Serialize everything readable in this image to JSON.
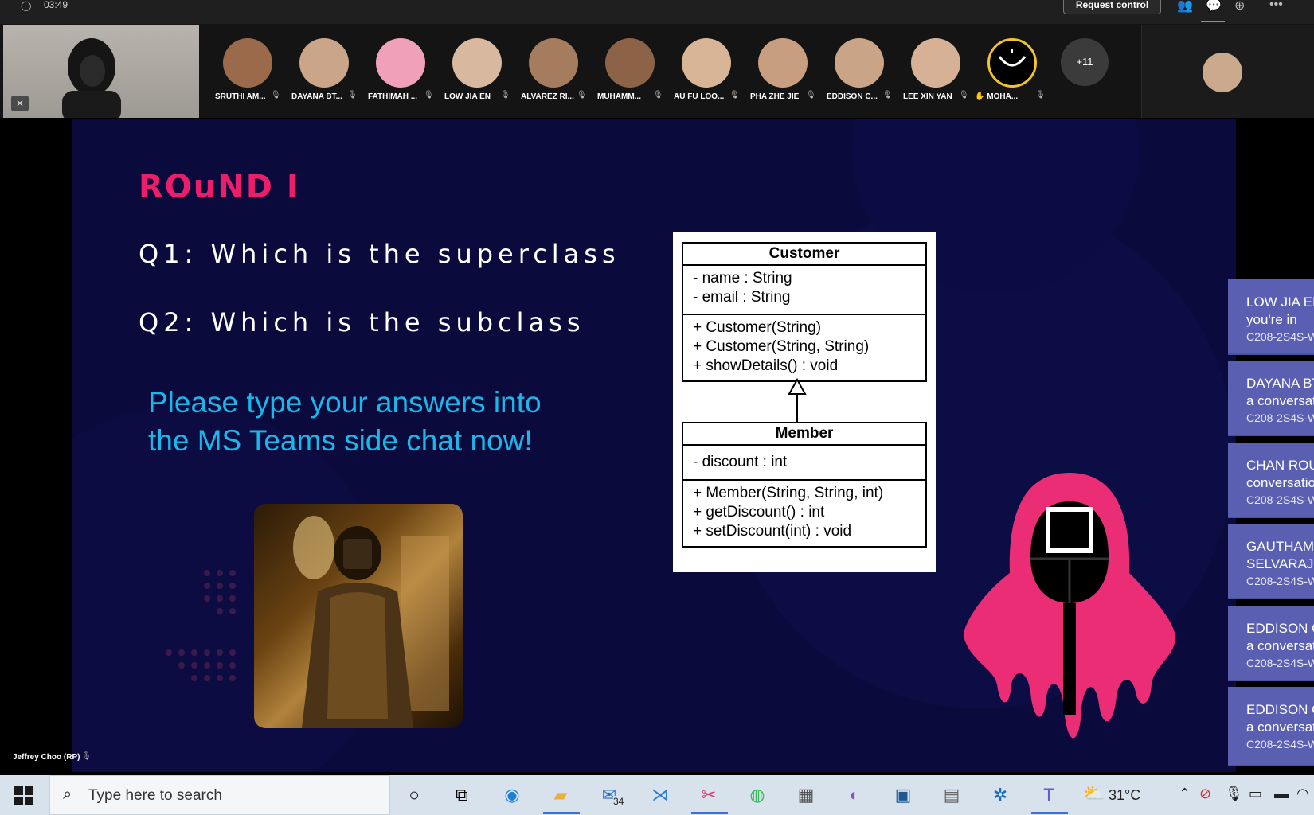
{
  "topbar": {
    "timer": "03:49",
    "request_control": "Request control"
  },
  "participants": [
    {
      "name": "SRUTHI AM..."
    },
    {
      "name": "DAYANA BT..."
    },
    {
      "name": "FATHIMAH ..."
    },
    {
      "name": "LOW JIA EN"
    },
    {
      "name": "ALVAREZ RI..."
    },
    {
      "name": "MUHAMM..."
    },
    {
      "name": "AU FU LOO..."
    },
    {
      "name": "PHA ZHE JIE"
    },
    {
      "name": "EDDISON C..."
    },
    {
      "name": "LEE XIN YAN"
    },
    {
      "name": "MOHA..."
    }
  ],
  "more_participants": "+11",
  "slide": {
    "round_title": "ROuND I",
    "q1": "Q1: Which is the superclass",
    "q2": "Q2: Which is the subclass",
    "instruction_line1": "Please type your answers into",
    "instruction_line2": "the MS Teams side chat now!"
  },
  "uml": {
    "customer": {
      "title": "Customer",
      "attributes": [
        "- name : String",
        "- email : String"
      ],
      "methods": [
        "+ Customer(String)",
        "+ Customer(String, String)",
        "+ showDetails() : void"
      ]
    },
    "member": {
      "title": "Member",
      "attributes": [
        "- discount : int"
      ],
      "methods": [
        "+ Member(String, String, int)",
        "+ getDiscount() : int",
        "+ setDiscount(int) : void"
      ]
    }
  },
  "presenter_name": "Jeffrey Choo (RP)",
  "notifications": [
    {
      "line1": "LOW JIA EN",
      "line2": "you're in",
      "line3": "C208-2S4S-W"
    },
    {
      "line1": "DAYANA BT",
      "line2": "a conversati",
      "line3": "C208-2S4S-W"
    },
    {
      "line1": "CHAN ROU",
      "line2": "conversatio",
      "line3": "C208-2S4S-W"
    },
    {
      "line1": "GAUTHAM",
      "line2": "SELVARAJU",
      "line3": "C208-2S4S-W"
    },
    {
      "line1": "EDDISON C",
      "line2": "a conversati",
      "line3": "C208-2S4S-W"
    },
    {
      "line1": "EDDISON C",
      "line2": "a conversati",
      "line3": "C208-2S4S-W"
    }
  ],
  "taskbar": {
    "search_placeholder": "Type here to search",
    "mail_badge": "34",
    "temperature": "31°C"
  },
  "colors": {
    "slide_bg": "#0a0a3c",
    "round_title": "#ec1e6c",
    "instruction": "#1ab7ea",
    "notification": "#5b5fb2",
    "taskbar": "#d8e2ec"
  }
}
